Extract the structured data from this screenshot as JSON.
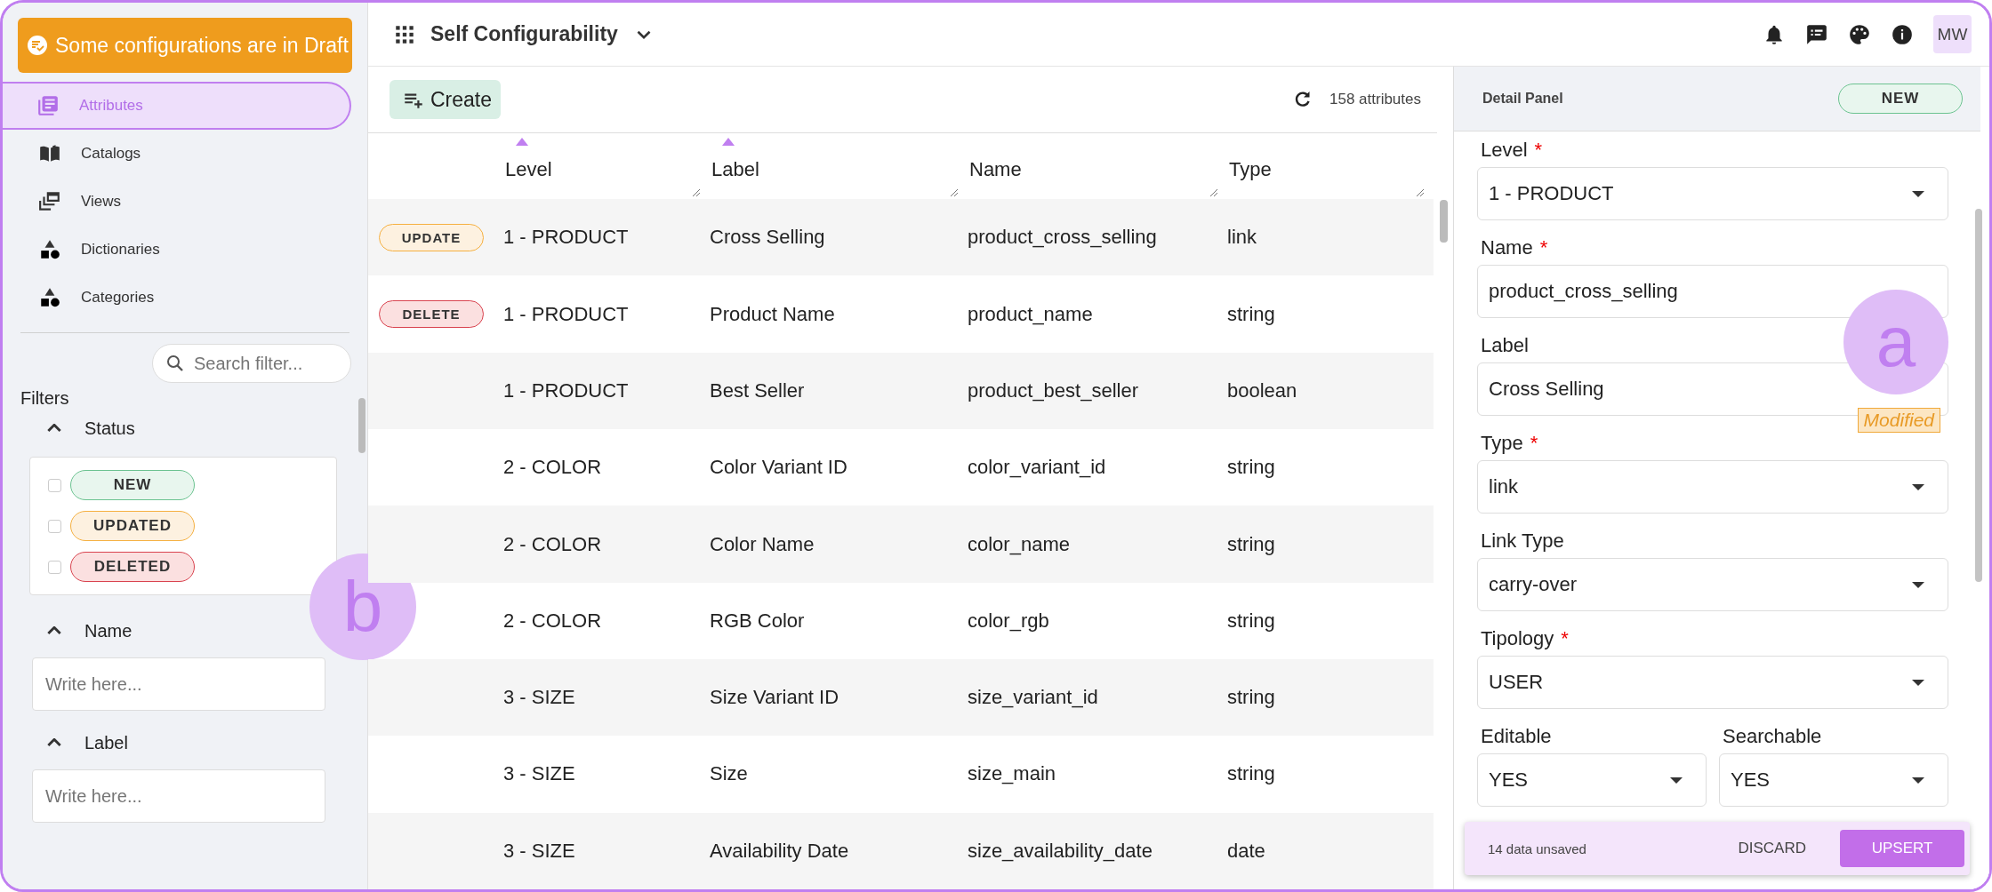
{
  "draft_banner": {
    "label": "Some configurations are in Draft"
  },
  "nav": [
    {
      "label": "Attributes",
      "kind": "list",
      "selected": true
    },
    {
      "label": "Catalogs",
      "kind": "book",
      "selected": false
    },
    {
      "label": "Views",
      "kind": "views",
      "selected": false
    },
    {
      "label": "Dictionaries",
      "kind": "shapes",
      "selected": false
    },
    {
      "label": "Categories",
      "kind": "shapes",
      "selected": false
    }
  ],
  "filter_search": {
    "placeholder": "Search filter..."
  },
  "filters": {
    "title": "Filters",
    "callout": "b",
    "status": {
      "label": "Status",
      "expanded": true,
      "options": [
        {
          "label": "NEW",
          "kind": "new",
          "checked": false
        },
        {
          "label": "UPDATED",
          "kind": "updated",
          "checked": false
        },
        {
          "label": "DELETED",
          "kind": "deleted",
          "checked": false
        }
      ]
    },
    "fields": [
      {
        "label": "Name",
        "expanded": true,
        "placeholder": "Write here..."
      },
      {
        "label": "Label",
        "expanded": true,
        "placeholder": "Write here..."
      }
    ]
  },
  "header": {
    "title": "Self Configurability",
    "avatar": "MW"
  },
  "toolbar": {
    "create": "Create",
    "count": "158 attributes"
  },
  "table": {
    "columns": [
      {
        "label": "Level",
        "sorted": true
      },
      {
        "label": "Label",
        "sorted": true
      },
      {
        "label": "Name",
        "sorted": false
      },
      {
        "label": "Type",
        "sorted": false
      }
    ],
    "rows": [
      {
        "badge": {
          "label": "UPDATE",
          "kind": "updated"
        },
        "cells": [
          "1 - PRODUCT",
          "Cross Selling",
          "product_cross_selling",
          "link"
        ]
      },
      {
        "badge": {
          "label": "DELETE",
          "kind": "deleted"
        },
        "cells": [
          "1 - PRODUCT",
          "Product Name",
          "product_name",
          "string"
        ]
      },
      {
        "cells": [
          "1 - PRODUCT",
          "Best Seller",
          "product_best_seller",
          "boolean"
        ]
      },
      {
        "cells": [
          "2 - COLOR",
          "Color Variant ID",
          "color_variant_id",
          "string"
        ]
      },
      {
        "cells": [
          "2 - COLOR",
          "Color Name",
          "color_name",
          "string"
        ]
      },
      {
        "cells": [
          "2 - COLOR",
          "RGB Color",
          "color_rgb",
          "string"
        ]
      },
      {
        "cells": [
          "3 - SIZE",
          "Size Variant ID",
          "size_variant_id",
          "string"
        ]
      },
      {
        "cells": [
          "3 - SIZE",
          "Size",
          "size_main",
          "string"
        ]
      },
      {
        "cells": [
          "3 - SIZE",
          "Availability Date",
          "size_availability_date",
          "date"
        ]
      }
    ]
  },
  "detail": {
    "title": "Detail Panel",
    "status": {
      "label": "NEW",
      "kind": "new"
    },
    "callout": "a",
    "fields": [
      {
        "label": "Level",
        "required_mark": "*",
        "kind": "select",
        "value": "1 - PRODUCT"
      },
      {
        "label": "Name",
        "required_mark": "*",
        "kind": "text",
        "value": "product_cross_selling"
      },
      {
        "label": "Label",
        "kind": "text",
        "value": "Cross Selling",
        "note": "Modified"
      },
      {
        "label": "Type",
        "required_mark": "*",
        "kind": "select",
        "value": "link"
      },
      {
        "label": "Link Type",
        "kind": "select",
        "value": "carry-over"
      },
      {
        "label": "Tipology",
        "required_mark": "*",
        "kind": "select",
        "value": "USER"
      }
    ],
    "pair": [
      {
        "label": "Editable",
        "kind": "select",
        "value": "YES"
      },
      {
        "label": "Searchable",
        "kind": "select",
        "value": "YES"
      }
    ]
  },
  "unsaved": {
    "message": "14 data unsaved",
    "discard": "DISCARD",
    "upsert": "UPSERT"
  }
}
